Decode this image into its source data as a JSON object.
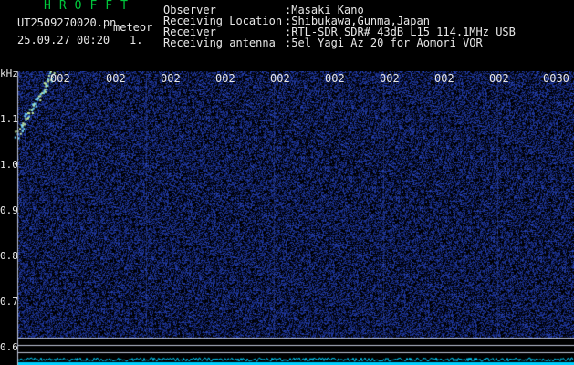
{
  "header": {
    "app_name": "HROFFT",
    "file_name": "UT2509270020.pn",
    "tag": "meteor",
    "date_time": "25.09.27 00:20",
    "frame": "1.",
    "info": [
      {
        "label": "Observer",
        "value": ":Masaki Kano"
      },
      {
        "label": "Receiving Location",
        "value": ":Shibukawa,Gunma,Japan"
      },
      {
        "label": "Receiver",
        "value": ":RTL-SDR SDR# 43dB L15 114.1MHz USB"
      },
      {
        "label": "Receiving antenna",
        "value": ":5el Yagi Az 20 for Aomori VOR"
      }
    ]
  },
  "axis": {
    "unit": "kHz",
    "y_ticks": [
      "1.1",
      "1.0",
      "0.9",
      "0.8",
      "0.7",
      "0.6"
    ],
    "x_ticks": [
      "002",
      "002",
      "002",
      "002",
      "002",
      "002",
      "002",
      "002",
      "002",
      "0030"
    ]
  },
  "colors": {
    "background": "#000000",
    "noise": "#1a2a8c",
    "trail": "#6fd6ff",
    "grid": "#bfc6d8",
    "baseline": "#00d0ff",
    "app_name": "#00c83c"
  }
}
